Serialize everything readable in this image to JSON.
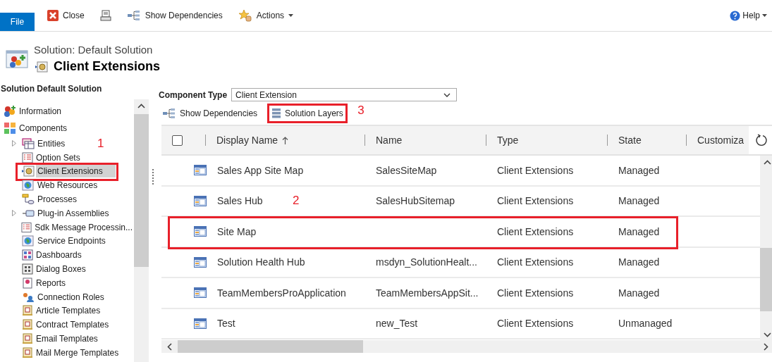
{
  "toolbar": {
    "file_tab": "File",
    "buttons": [
      {
        "kind": "close",
        "label": "Close"
      },
      {
        "kind": "print"
      },
      {
        "kind": "dependencies",
        "label": "Show Dependencies"
      },
      {
        "kind": "actions",
        "label": "Actions"
      }
    ],
    "help": "Help"
  },
  "header": {
    "subtitle": "Solution: Default Solution",
    "title": "Client Extensions"
  },
  "sidebar": {
    "title": "Solution Default Solution",
    "items": [
      {
        "label": "Information",
        "kind": "information",
        "selected": false
      },
      {
        "label": "Components",
        "kind": "components",
        "selected": false,
        "children": [
          {
            "label": "Entities",
            "kind": "entities",
            "expandable": true,
            "selected": false
          },
          {
            "label": "Option Sets",
            "kind": "list",
            "expandable": false,
            "selected": false
          },
          {
            "label": "Client Extensions",
            "kind": "extension",
            "expandable": false,
            "selected": true,
            "callout": "1"
          },
          {
            "label": "Web Resources",
            "kind": "globe",
            "expandable": false,
            "selected": false
          },
          {
            "label": "Processes",
            "kind": "process",
            "expandable": false,
            "selected": false
          },
          {
            "label": "Plug-in Assemblies",
            "kind": "plugin",
            "expandable": true,
            "selected": false
          },
          {
            "label": "Sdk Message Processin...",
            "kind": "list",
            "expandable": false,
            "selected": false
          },
          {
            "label": "Service Endpoints",
            "kind": "globe",
            "expandable": false,
            "selected": false
          },
          {
            "label": "Dashboards",
            "kind": "dashboard",
            "expandable": false,
            "selected": false
          },
          {
            "label": "Dialog Boxes",
            "kind": "dialog",
            "expandable": false,
            "selected": false
          },
          {
            "label": "Reports",
            "kind": "report",
            "expandable": false,
            "selected": false
          },
          {
            "label": "Connection Roles",
            "kind": "people",
            "expandable": false,
            "selected": false
          },
          {
            "label": "Article Templates",
            "kind": "template",
            "expandable": false,
            "selected": false
          },
          {
            "label": "Contract Templates",
            "kind": "template",
            "expandable": false,
            "selected": false
          },
          {
            "label": "Email Templates",
            "kind": "template",
            "expandable": false,
            "selected": false
          },
          {
            "label": "Mail Merge Templates",
            "kind": "template",
            "expandable": false,
            "selected": false
          }
        ]
      }
    ]
  },
  "filter": {
    "label": "Component Type",
    "value": "Client Extension"
  },
  "grid_toolbar": [
    {
      "kind": "dependencies",
      "label": "Show Dependencies"
    },
    {
      "kind": "layers",
      "label": "Solution Layers",
      "callout": "3"
    }
  ],
  "table": {
    "select_all": {
      "checked": false
    },
    "columns": [
      {
        "label": "Display Name",
        "sorted": true
      },
      {
        "label": "Name",
        "sorted": false
      },
      {
        "label": "Type",
        "sorted": false
      },
      {
        "label": "State",
        "sorted": false
      },
      {
        "label": "Customiza",
        "sorted": false
      }
    ],
    "rows": [
      {
        "cells": [
          "Sales App Site Map",
          "SalesSiteMap",
          "Client Extensions",
          "Managed"
        ]
      },
      {
        "cells": [
          "Sales Hub",
          "SalesHubSitemap",
          "Client Extensions",
          "Managed"
        ]
      },
      {
        "cells": [
          "Site Map",
          "",
          "Client Extensions",
          "Managed"
        ],
        "callout": "2"
      },
      {
        "cells": [
          "Solution Health Hub",
          "msdyn_SolutionHealt...",
          "Client Extensions",
          "Managed"
        ]
      },
      {
        "cells": [
          "TeamMembersProApplication",
          "TeamMembersAppSit...",
          "Client Extensions",
          "Managed"
        ]
      },
      {
        "cells": [
          "Test",
          "new_Test",
          "Client Extensions",
          "Unmanaged"
        ]
      }
    ]
  }
}
